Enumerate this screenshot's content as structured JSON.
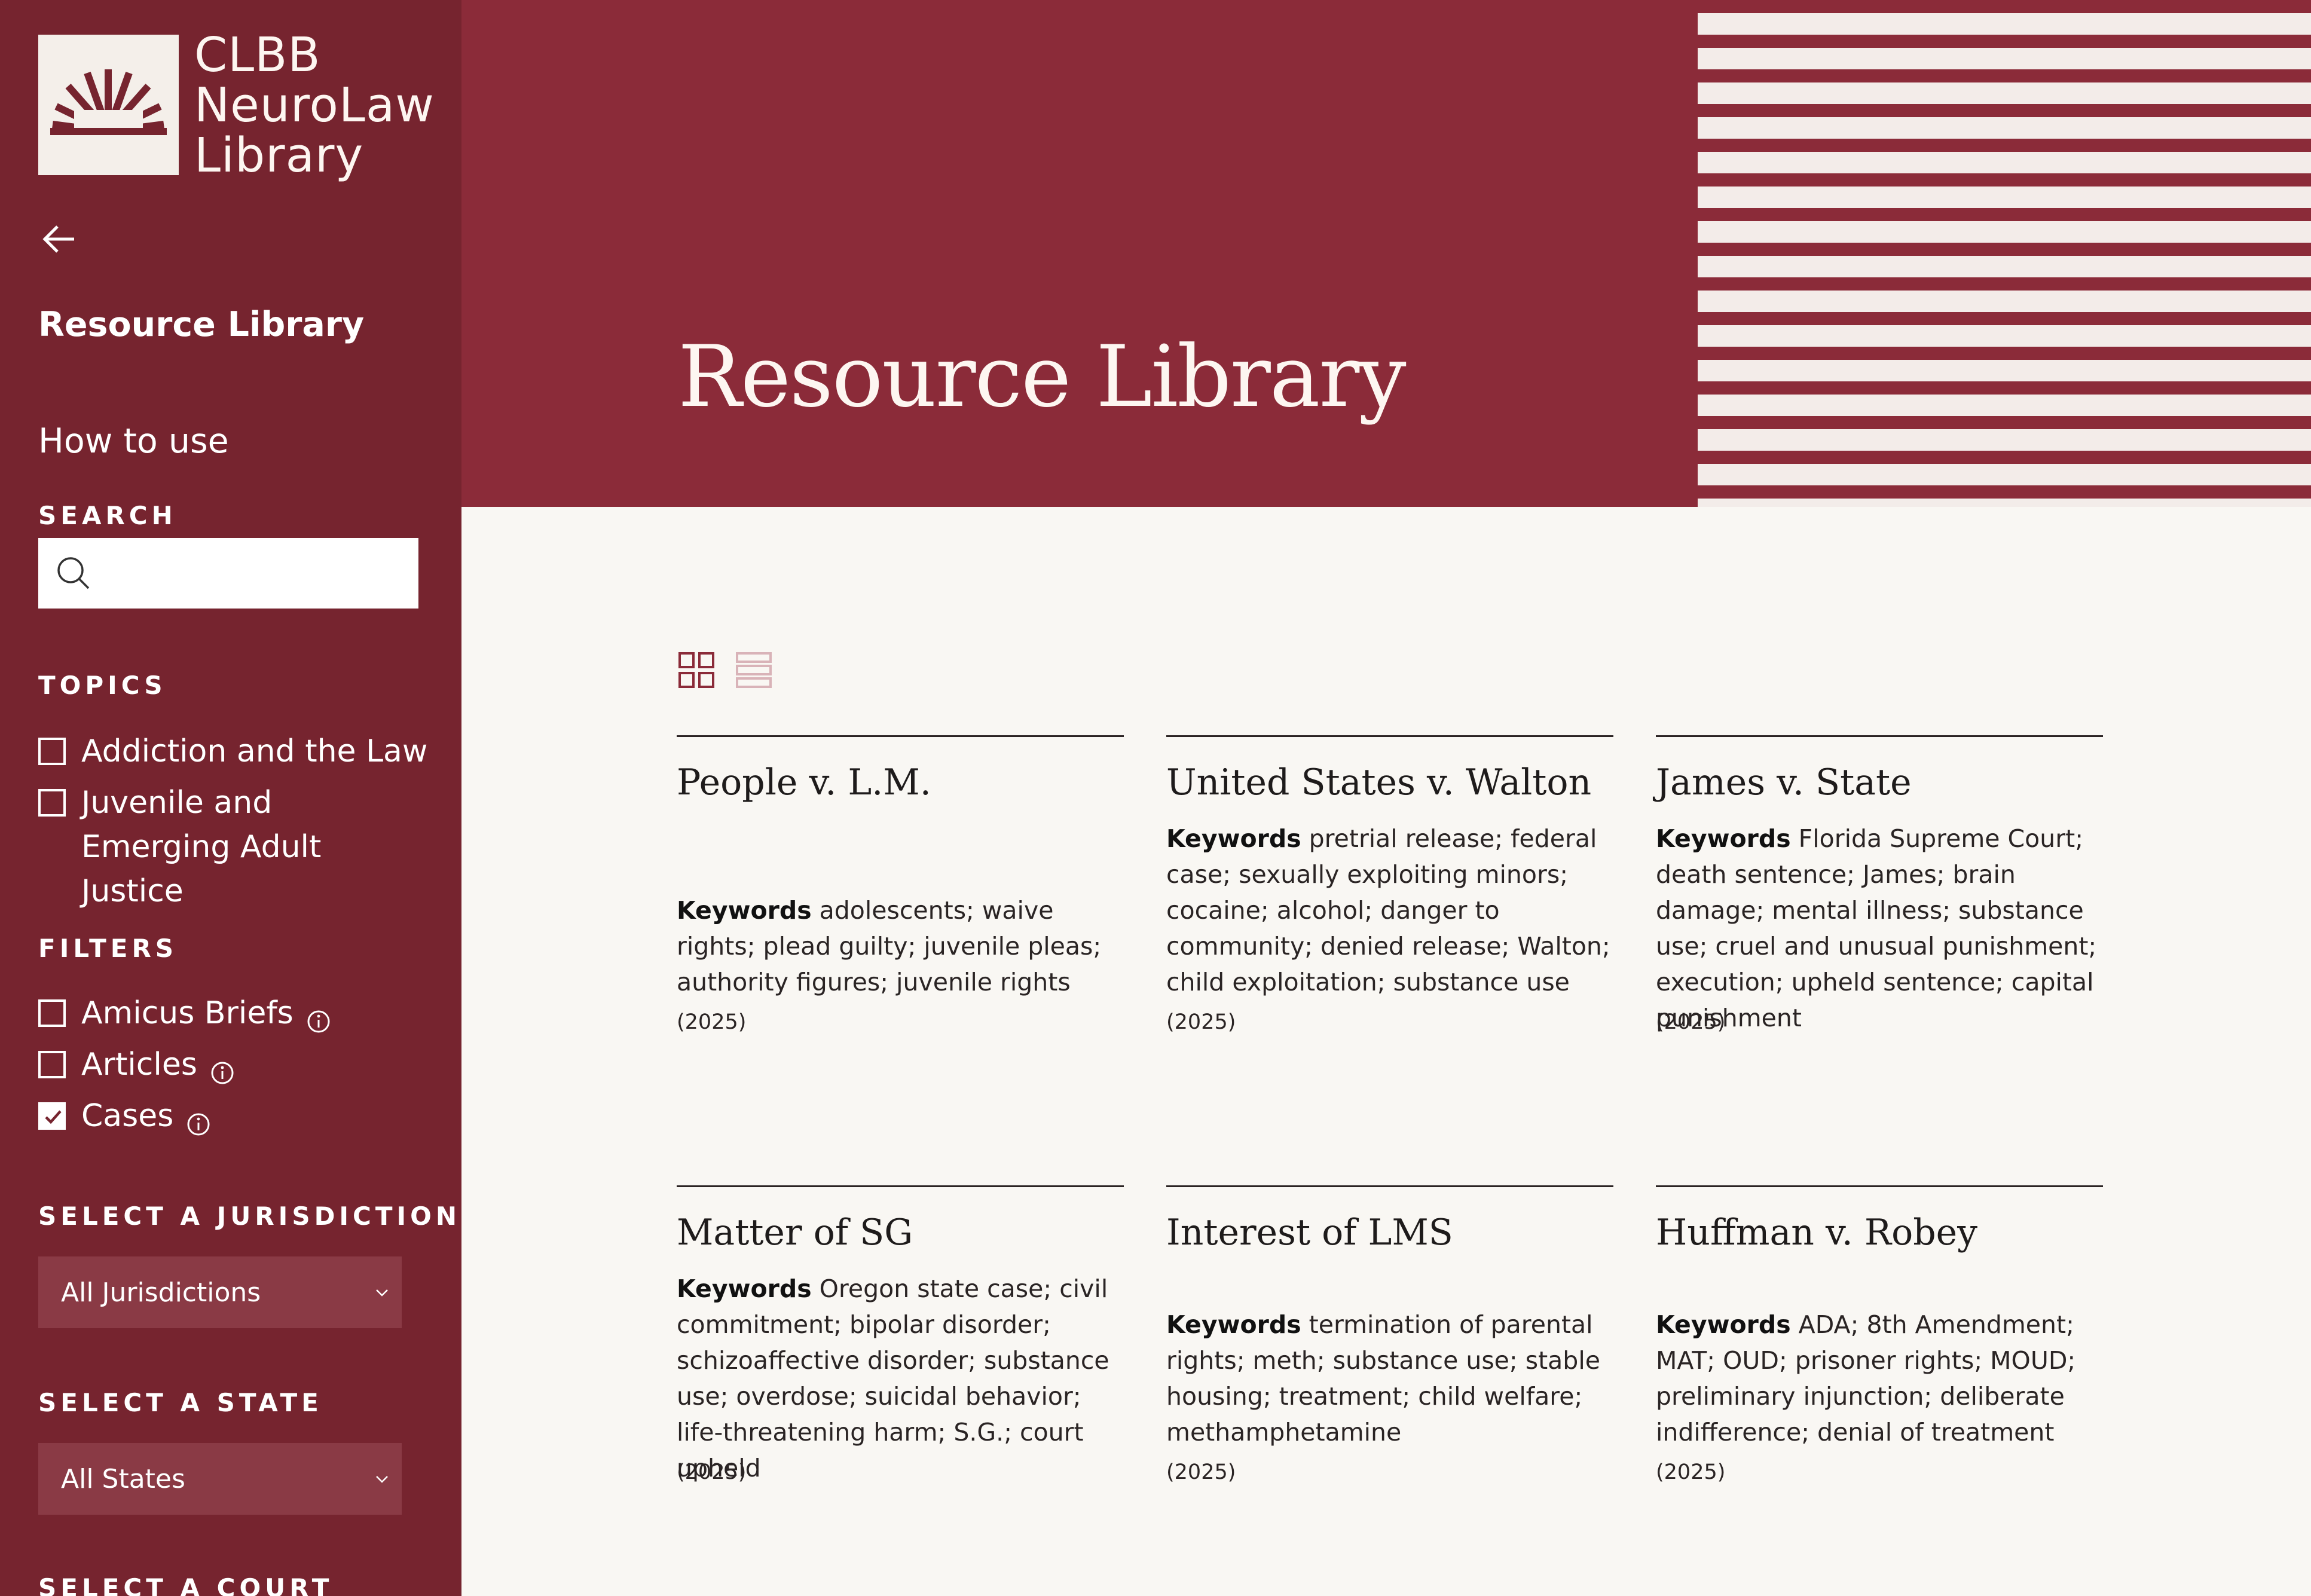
{
  "brand": {
    "name_lines": [
      "CLBB",
      "NeuroLaw",
      "Library"
    ]
  },
  "sidebar": {
    "title": "Resource Library",
    "how_to_use": "How to use",
    "search": {
      "label": "SEARCH",
      "placeholder": "",
      "value": ""
    },
    "topics": {
      "label": "TOPICS",
      "items": [
        {
          "label": "Addiction and the Law",
          "checked": false
        },
        {
          "label": "Juvenile and Emerging Adult Justice",
          "checked": false
        }
      ]
    },
    "filters": {
      "label": "FILTERS",
      "items": [
        {
          "label": "Amicus Briefs",
          "checked": false
        },
        {
          "label": "Articles",
          "checked": false
        },
        {
          "label": "Cases",
          "checked": true
        }
      ]
    },
    "jurisdiction": {
      "label": "SELECT A JURISDICTION",
      "value": "All Jurisdictions"
    },
    "state": {
      "label": "SELECT A STATE",
      "value": "All States"
    },
    "court": {
      "label": "SELECT A COURT"
    }
  },
  "header": {
    "title": "Resource Library"
  },
  "main": {
    "keywords_label": "Keywords",
    "cards": [
      {
        "title": "People v. L.M.",
        "keywords": "adolescents; waive rights; plead guilty; juvenile pleas; authority figures; juvenile rights",
        "year": "(2025)"
      },
      {
        "title": "United States v. Walton",
        "keywords": "pretrial release; federal case; sexually exploiting minors; cocaine; alcohol; danger to community; denied release; Walton; child exploitation; substance use",
        "year": "(2025)"
      },
      {
        "title": "James v. State",
        "keywords": "Florida Supreme Court; death sentence; James; brain damage; mental illness; substance use; cruel and unusual punishment; execution; upheld sentence; capital punishment",
        "year": "(2025)"
      },
      {
        "title": "Matter of SG",
        "keywords": "Oregon state case; civil commitment; bipolar disorder; schizoaffective disorder; substance use; overdose; suicidal behavior; life-threatening harm; S.G.; court upheld",
        "year": "(2025)"
      },
      {
        "title": "Interest of LMS",
        "keywords": "termination of parental rights; meth; substance use; stable housing; treatment; child welfare; methamphetamine",
        "year": "(2025)"
      },
      {
        "title": "Huffman v. Robey",
        "keywords": "ADA; 8th Amendment; MAT; OUD; prisoner rights; MOUD; preliminary injunction; deliberate indifference; denial of treatment",
        "year": "(2025)"
      }
    ]
  },
  "colors": {
    "sidebar_bg": "#76242f",
    "header_bg": "#8b2b39",
    "page_bg": "#f9f7f3",
    "stripe_light": "#f3ece9"
  },
  "icons": {
    "logo": "sunburst-logo-icon",
    "back": "arrow-left-icon",
    "search": "search-icon",
    "info": "info-icon",
    "select": "chevron-down-icon",
    "grid_view": "grid-view-icon",
    "list_view": "list-view-icon",
    "check": "checkmark-icon"
  }
}
